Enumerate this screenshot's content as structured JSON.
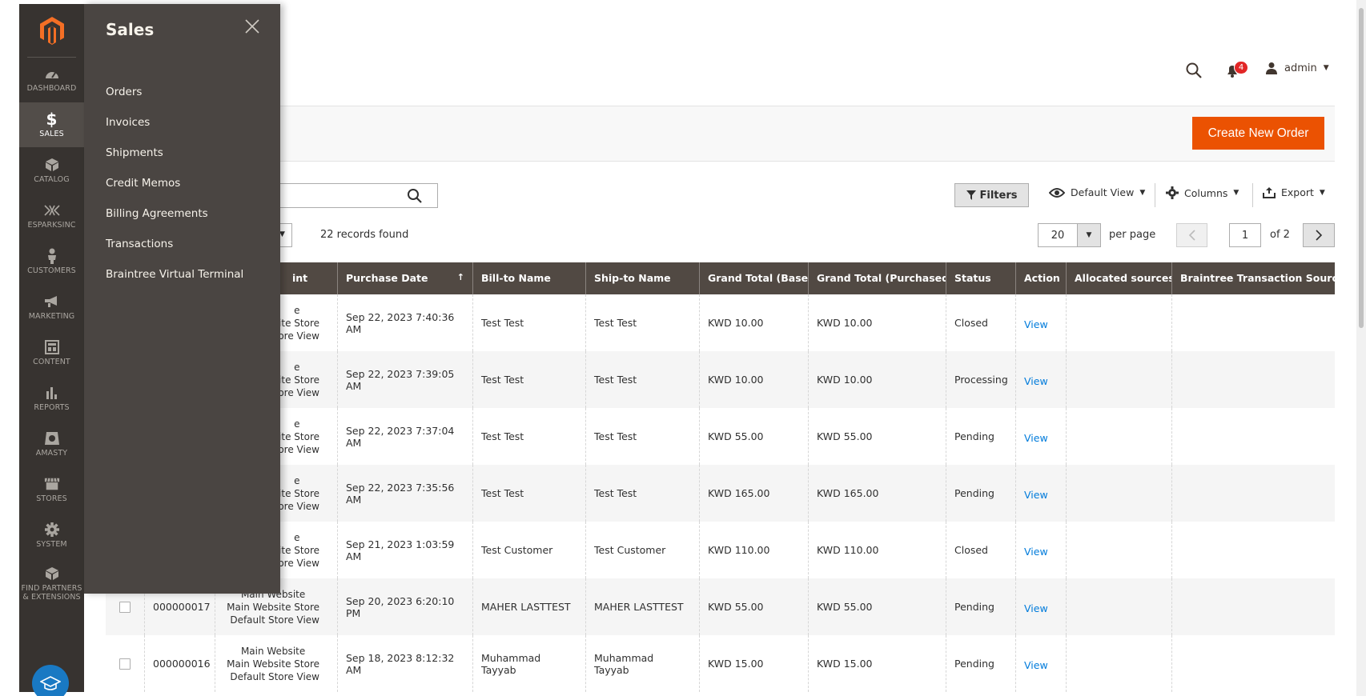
{
  "nav": {
    "items": [
      {
        "label": "DASHBOARD",
        "icon": "dashboard-icon"
      },
      {
        "label": "SALES",
        "icon": "dollar-icon"
      },
      {
        "label": "CATALOG",
        "icon": "box-icon"
      },
      {
        "label": "ESPARKSINC",
        "icon": "esparks-icon"
      },
      {
        "label": "CUSTOMERS",
        "icon": "customer-icon"
      },
      {
        "label": "MARKETING",
        "icon": "megaphone-icon"
      },
      {
        "label": "CONTENT",
        "icon": "layout-icon"
      },
      {
        "label": "REPORTS",
        "icon": "bar-chart-icon"
      },
      {
        "label": "AMASTY",
        "icon": "amasty-icon"
      },
      {
        "label": "STORES",
        "icon": "store-icon"
      },
      {
        "label": "SYSTEM",
        "icon": "gear-icon"
      },
      {
        "label": "FIND PARTNERS & EXTENSIONS",
        "icon": "partners-icon"
      }
    ]
  },
  "flyout": {
    "title": "Sales",
    "items": [
      "Orders",
      "Invoices",
      "Shipments",
      "Credit Memos",
      "Billing Agreements",
      "Transactions",
      "Braintree Virtual Terminal"
    ]
  },
  "header": {
    "notifications_count": "4",
    "user": "admin"
  },
  "toolbar": {
    "create_label": "Create New Order",
    "filters_label": "Filters",
    "view_label": "Default View",
    "columns_label": "Columns",
    "export_label": "Export",
    "records": "22 records found",
    "per_page_value": "20",
    "per_page_label": "per page",
    "page_value": "1",
    "page_of": "of 2"
  },
  "colors": {
    "accent": "#eb5202",
    "nav_bg": "#373330",
    "header_bg": "#514943",
    "link": "#007bdb"
  },
  "table": {
    "headers": [
      "",
      "",
      "int",
      "Purchase Date",
      "Bill-to Name",
      "Ship-to Name",
      "Grand Total (Base)",
      "Grand Total (Purchased)",
      "Status",
      "Action",
      "Allocated sources",
      "Braintree Transaction Source"
    ],
    "rows": [
      {
        "id": "",
        "pos1": "e",
        "pos2": "ite Store",
        "pos3": "tore View",
        "date": "Sep 22, 2023 7:40:36 AM",
        "bill": "Test Test",
        "ship": "Test Test",
        "base": "KWD 10.00",
        "purchased": "KWD 10.00",
        "status": "Closed",
        "action": "View"
      },
      {
        "id": "",
        "pos1": "e",
        "pos2": "ite Store",
        "pos3": "tore View",
        "date": "Sep 22, 2023 7:39:05 AM",
        "bill": "Test Test",
        "ship": "Test Test",
        "base": "KWD 10.00",
        "purchased": "KWD 10.00",
        "status": "Processing",
        "action": "View"
      },
      {
        "id": "",
        "pos1": "e",
        "pos2": "ite Store",
        "pos3": "tore View",
        "date": "Sep 22, 2023 7:37:04 AM",
        "bill": "Test Test",
        "ship": "Test Test",
        "base": "KWD 55.00",
        "purchased": "KWD 55.00",
        "status": "Pending",
        "action": "View"
      },
      {
        "id": "",
        "pos1": "e",
        "pos2": "ite Store",
        "pos3": "tore View",
        "date": "Sep 22, 2023 7:35:56 AM",
        "bill": "Test Test",
        "ship": "Test Test",
        "base": "KWD 165.00",
        "purchased": "KWD 165.00",
        "status": "Pending",
        "action": "View"
      },
      {
        "id": "",
        "pos1": "e",
        "pos2": "ite Store",
        "pos3": "tore View",
        "date": "Sep 21, 2023 1:03:59 AM",
        "bill": "Test Customer",
        "ship": "Test Customer",
        "base": "KWD 110.00",
        "purchased": "KWD 110.00",
        "status": "Closed",
        "action": "View"
      },
      {
        "id": "000000017",
        "pos1": "Main Website",
        "pos2": "Main Website Store",
        "pos3": "Default Store View",
        "date": "Sep 20, 2023 6:20:10 PM",
        "bill": "MAHER LASTTEST",
        "ship": "MAHER LASTTEST",
        "base": "KWD 55.00",
        "purchased": "KWD 55.00",
        "status": "Pending",
        "action": "View"
      },
      {
        "id": "000000016",
        "pos1": "Main Website",
        "pos2": "Main Website Store",
        "pos3": "Default Store View",
        "date": "Sep 18, 2023 8:12:32 AM",
        "bill": "Muhammad Tayyab",
        "ship": "Muhammad Tayyab",
        "base": "KWD 15.00",
        "purchased": "KWD 15.00",
        "status": "Pending",
        "action": "View"
      }
    ]
  }
}
